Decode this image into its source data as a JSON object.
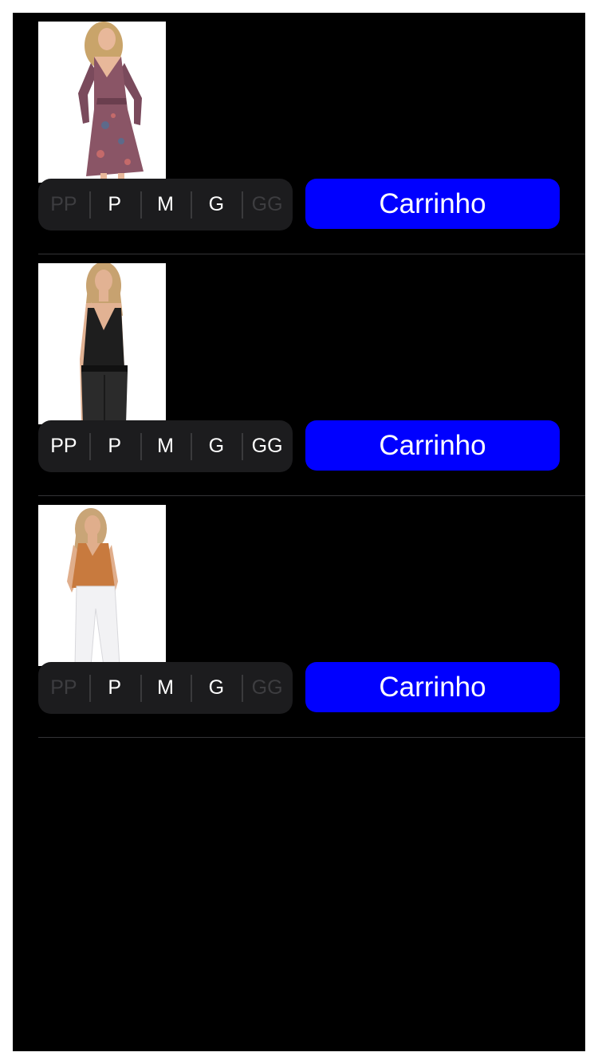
{
  "colors": {
    "screen_background": "#000000",
    "segment_background": "#1c1c1e",
    "segment_text_enabled": "#ffffff",
    "segment_text_disabled": "#3d3d40",
    "cart_button": "#0000ff",
    "divider": "#333336"
  },
  "products": [
    {
      "image": "dress-photo",
      "sizes": [
        {
          "label": "PP",
          "available": false
        },
        {
          "label": "P",
          "available": true
        },
        {
          "label": "M",
          "available": true
        },
        {
          "label": "G",
          "available": true
        },
        {
          "label": "GG",
          "available": false
        }
      ],
      "cart_label": "Carrinho"
    },
    {
      "image": "black-top-photo",
      "sizes": [
        {
          "label": "PP",
          "available": true
        },
        {
          "label": "P",
          "available": true
        },
        {
          "label": "M",
          "available": true
        },
        {
          "label": "G",
          "available": true
        },
        {
          "label": "GG",
          "available": true
        }
      ],
      "cart_label": "Carrinho"
    },
    {
      "image": "orange-top-photo",
      "sizes": [
        {
          "label": "PP",
          "available": false
        },
        {
          "label": "P",
          "available": true
        },
        {
          "label": "M",
          "available": true
        },
        {
          "label": "G",
          "available": true
        },
        {
          "label": "GG",
          "available": false
        }
      ],
      "cart_label": "Carrinho"
    }
  ]
}
